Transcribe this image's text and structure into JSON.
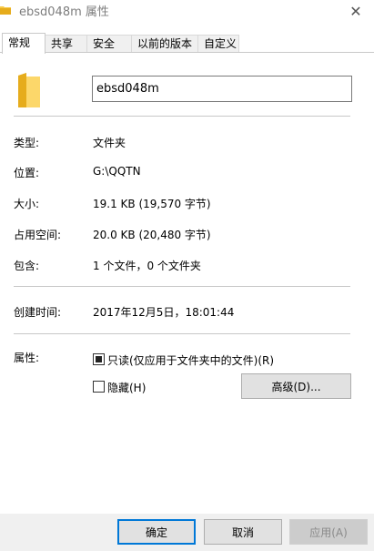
{
  "window": {
    "title": "ebsd048m 属性"
  },
  "tabs": [
    {
      "label": "常规"
    },
    {
      "label": "共享"
    },
    {
      "label": "安全"
    },
    {
      "label": "以前的版本"
    },
    {
      "label": "自定义"
    }
  ],
  "general": {
    "name_value": "ebsd048m",
    "type": {
      "label": "类型:",
      "value": "文件夹"
    },
    "location": {
      "label": "位置:",
      "value": "G:\\QQTN"
    },
    "size": {
      "label": "大小:",
      "value": "19.1 KB (19,570 字节)"
    },
    "size_on_disk": {
      "label": "占用空间:",
      "value": "20.0 KB (20,480 字节)"
    },
    "contains": {
      "label": "包含:",
      "value": "1 个文件，0 个文件夹"
    },
    "created": {
      "label": "创建时间:",
      "value": "2017年12月5日，18:01:44"
    },
    "attributes": {
      "label": "属性:",
      "readonly_label": "只读(仅应用于文件夹中的文件)(R)",
      "readonly_state": "indeterminate",
      "hidden_label": "隐藏(H)",
      "hidden_state": "unchecked",
      "advanced_label": "高级(D)..."
    }
  },
  "footer": {
    "ok_label": "确定",
    "cancel_label": "取消",
    "apply_label": "应用(A)"
  },
  "colors": {
    "accent": "#0078d7",
    "folder": "#f7c948",
    "folder_dark": "#e6ac1c"
  },
  "icons": [
    "folder-icon",
    "close-icon"
  ]
}
